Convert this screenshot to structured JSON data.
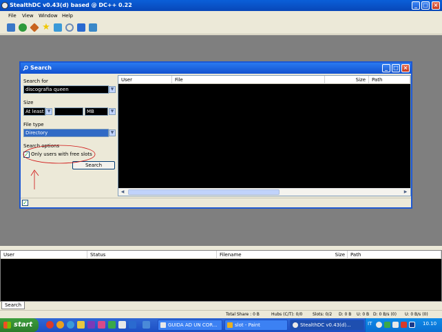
{
  "window": {
    "title": "StealthDC v0.43(d) based @ DC++ 0.22",
    "btn_min": "_",
    "btn_max": "□",
    "btn_close": "×"
  },
  "menu": [
    "File",
    "View",
    "Window",
    "Help"
  ],
  "toolbar": {
    "icons": [
      "public-hubs-icon",
      "reconnect-icon",
      "follow-redirect-icon",
      "favorites-icon",
      "users-icon",
      "search-icon",
      "adl-search-icon",
      "notepad-icon"
    ],
    "colors": [
      "#3a78c8",
      "#2e9a3a",
      "#c8641e",
      "#f0c800",
      "#3a9ad8",
      "#6a8ab8",
      "#2a6ad0",
      "#3a88c8"
    ]
  },
  "search_window": {
    "title": "Search",
    "search_for_label": "Search for",
    "search_for_value": "discografia queen",
    "size_label": "Size",
    "size_mode": "At least",
    "size_value": "",
    "size_unit": "MB",
    "file_type_label": "File type",
    "file_type_value": "Directory",
    "options_label": "Search options",
    "only_free_slots_label": "Only users with free slots",
    "only_free_slots_checked": true,
    "search_button": "Search",
    "columns": [
      "User",
      "File",
      "Size",
      "Path"
    ]
  },
  "transfers": {
    "columns": [
      "User",
      "Status",
      "Filename",
      "Size",
      "Path"
    ]
  },
  "tabs": [
    "Search"
  ],
  "status_bar": {
    "total_share": "Total Share : 0 B",
    "hubs": "Hubs (C/T): 0/0",
    "slots": "Slots: 0/2",
    "d": "D: 0 B",
    "u": "U: 0 B",
    "d_rate": "D: 0 B/s (0)",
    "u_rate": "U: 0 B/s (0)"
  },
  "taskbar": {
    "start": "start",
    "tasks": [
      "GUIDA AD UN COR...",
      "slot - Paint",
      "StealthDC v0.43(d)..."
    ],
    "lang": "IT",
    "clock": "10.10"
  }
}
